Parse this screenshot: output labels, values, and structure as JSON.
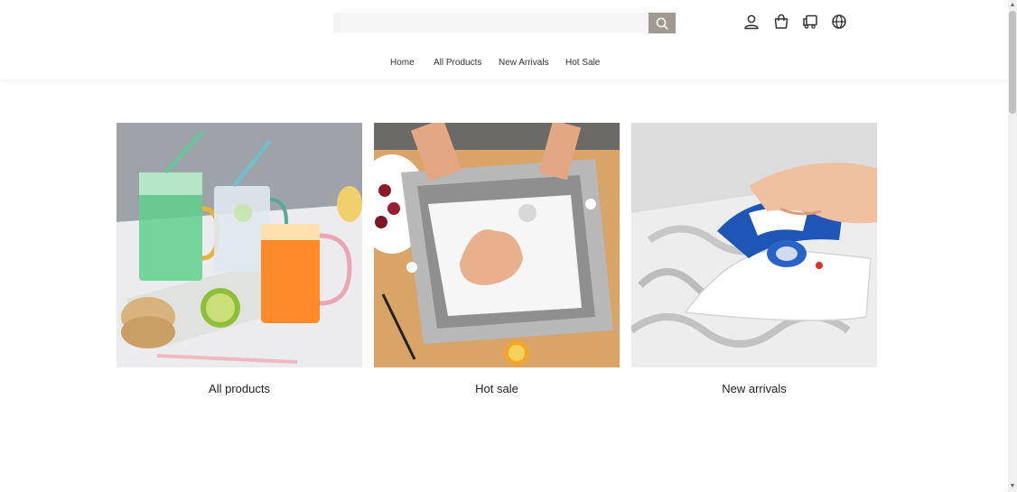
{
  "header": {
    "search": {
      "placeholder": "",
      "value": ""
    },
    "icons": [
      "search-icon",
      "account-icon",
      "cart-icon",
      "shipping-icon",
      "globe-icon"
    ]
  },
  "nav": {
    "items": [
      "Home",
      "All Products",
      "New Arrivals",
      "Hot Sale"
    ]
  },
  "categories": [
    {
      "label": "All products",
      "image": "colored-glass-jars-with-straws"
    },
    {
      "label": "Hot sale",
      "image": "collapsible-cutting-board-basin"
    },
    {
      "label": "New arrivals",
      "image": "blue-white-travel-steam-iron"
    }
  ],
  "colors": {
    "search_button": "#a09a92",
    "accent_grey": "#a09a92"
  }
}
